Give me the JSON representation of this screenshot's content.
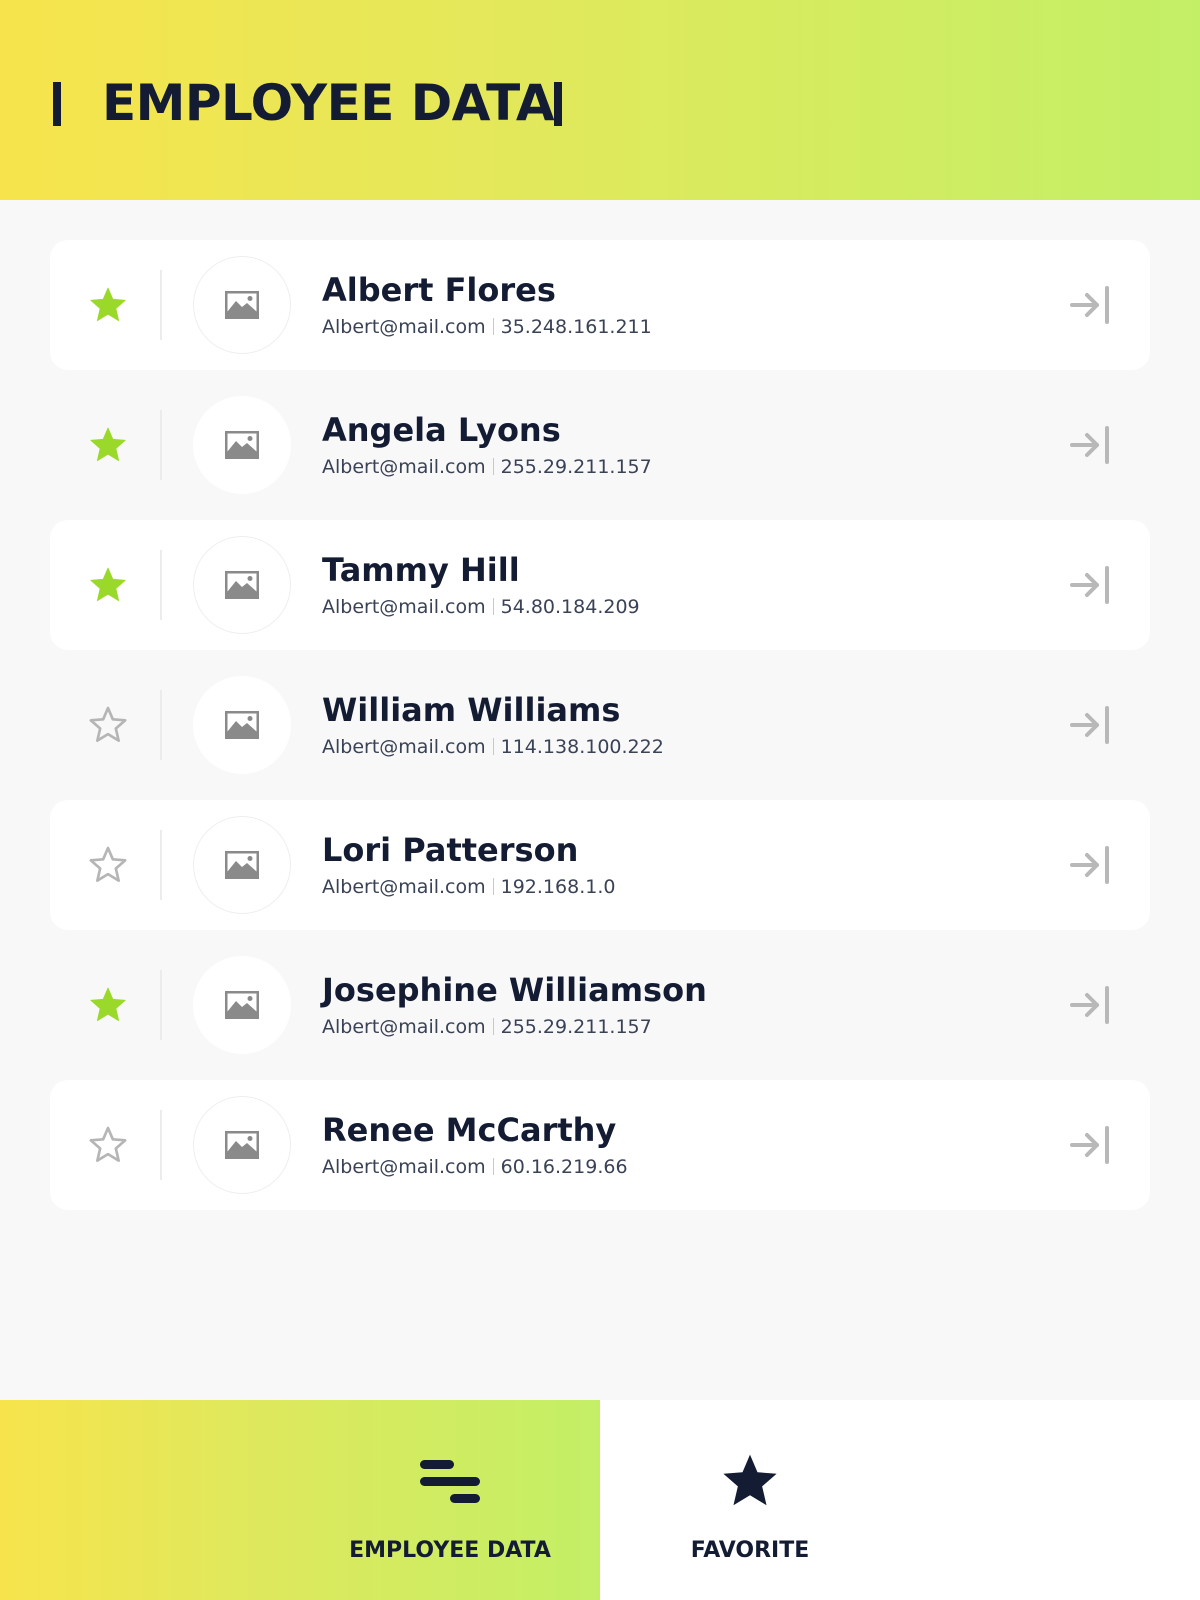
{
  "header": {
    "title": "EMPLOYEE DATA"
  },
  "colors": {
    "accent_green": "#9ad92a",
    "star_outline": "#b5b5b5",
    "text_dark": "#131c33",
    "gradient_start": "#f7e44c",
    "gradient_end": "#c3ef66"
  },
  "employees": [
    {
      "name": "Albert Flores",
      "email": "Albert@mail.com",
      "ip": "35.248.161.211",
      "favorite": true
    },
    {
      "name": "Angela Lyons",
      "email": "Albert@mail.com",
      "ip": "255.29.211.157",
      "favorite": true
    },
    {
      "name": "Tammy Hill",
      "email": "Albert@mail.com",
      "ip": "54.80.184.209",
      "favorite": true
    },
    {
      "name": "William Williams",
      "email": "Albert@mail.com",
      "ip": "114.138.100.222",
      "favorite": false
    },
    {
      "name": "Lori Patterson",
      "email": "Albert@mail.com",
      "ip": "192.168.1.0",
      "favorite": false
    },
    {
      "name": "Josephine Williamson",
      "email": "Albert@mail.com",
      "ip": "255.29.211.157",
      "favorite": true
    },
    {
      "name": "Renee McCarthy",
      "email": "Albert@mail.com",
      "ip": "60.16.219.66",
      "favorite": false
    }
  ],
  "icons": {
    "favorite": "star-icon",
    "avatar": "image-placeholder-icon",
    "open": "arrow-to-line-icon",
    "tab_employee": "menu-lines-icon",
    "tab_favorite": "star-icon"
  },
  "tabs": [
    {
      "label": "EMPLOYEE DATA",
      "active": true
    },
    {
      "label": "FAVORITE",
      "active": false
    }
  ]
}
